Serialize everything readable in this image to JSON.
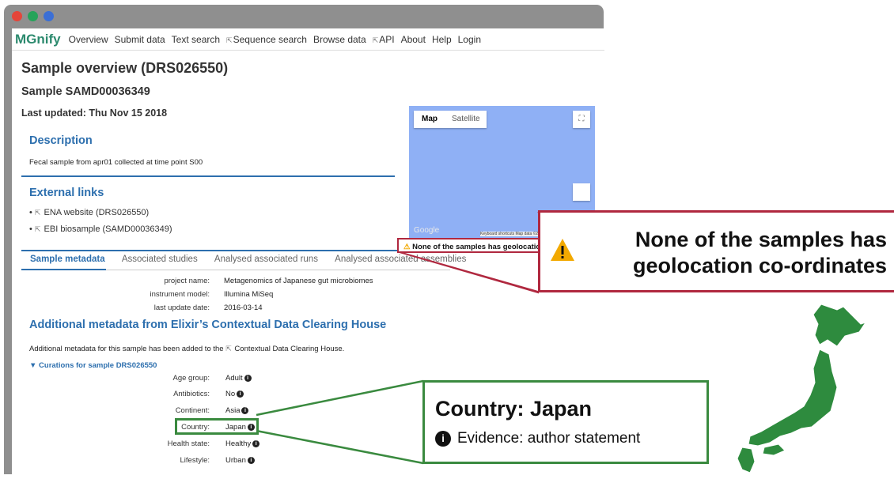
{
  "window": {
    "dot_colors": [
      "#e5453a",
      "#26a35a",
      "#3b6fd6"
    ]
  },
  "nav": {
    "logo": "MGnify",
    "items": [
      {
        "label": "Overview",
        "external": false
      },
      {
        "label": "Submit data",
        "external": false
      },
      {
        "label": "Text search",
        "external": false
      },
      {
        "label": "Sequence search",
        "external": true
      },
      {
        "label": "Browse data",
        "external": false
      },
      {
        "label": "API",
        "external": true
      },
      {
        "label": "About",
        "external": false
      },
      {
        "label": "Help",
        "external": false
      },
      {
        "label": "Login",
        "external": false
      }
    ]
  },
  "page": {
    "title": "Sample overview (DRS026550)",
    "subtitle": "Sample SAMD00036349",
    "last_updated": "Last updated: Thu Nov 15 2018"
  },
  "description": {
    "title": "Description",
    "text": "Fecal sample from apr01 collected at time point S00"
  },
  "external_links": {
    "title": "External links",
    "items": [
      "ENA website (DRS026550)",
      "EBI biosample (SAMD00036349)"
    ]
  },
  "map": {
    "map_button": "Map",
    "satellite_button": "Satellite",
    "zoom_in": "+",
    "zoom_out": "−",
    "google": "Google",
    "footer": "Keyboard shortcuts   Map data ©2023   Terms of Use"
  },
  "warning": {
    "text": "None of the samples has geolocation co-ordinates."
  },
  "tabs": [
    "Sample metadata",
    "Associated studies",
    "Analysed associated runs",
    "Analysed associated assemblies"
  ],
  "metadata": [
    {
      "key": "project name:",
      "value": "Metagenomics of Japanese gut microbiomes"
    },
    {
      "key": "instrument model:",
      "value": "Illumina MiSeq"
    },
    {
      "key": "last update date:",
      "value": "2016-03-14"
    }
  ],
  "elixir": {
    "title": "Additional metadata from Elixir’s Contextual Data Clearing House",
    "text_before": "Additional metadata for this sample has been added to the ",
    "link": "Contextual Data Clearing House.",
    "curations": "▼ Curations for sample DRS026550"
  },
  "curations": [
    {
      "key": "Age group:",
      "value": "Adult"
    },
    {
      "key": "Antibiotics:",
      "value": "No"
    },
    {
      "key": "Continent:",
      "value": "Asia"
    },
    {
      "key": "Country:",
      "value": "Japan"
    },
    {
      "key": "Health state:",
      "value": "Healthy"
    },
    {
      "key": "Lifestyle:",
      "value": "Urban"
    }
  ],
  "callout_geo": {
    "text": "None of the samples has geolocation co-ordinates",
    "color": "#b0283f"
  },
  "callout_country": {
    "title": "Country: Japan",
    "evidence": "Evidence: author statement",
    "color": "#3a8a3f"
  },
  "japan_map": {
    "color": "#2e8b3e"
  }
}
